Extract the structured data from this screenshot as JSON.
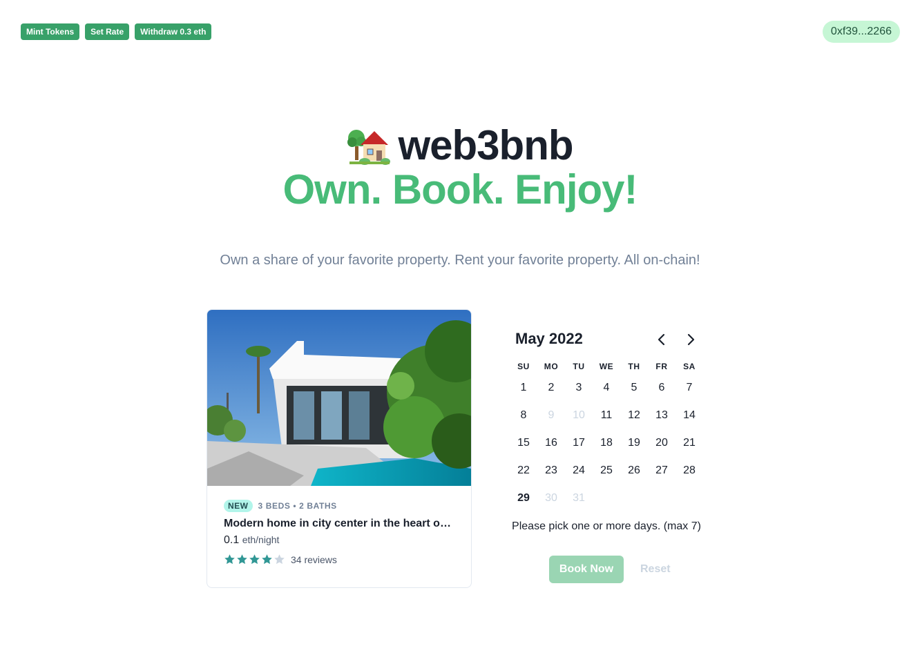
{
  "toolbar": {
    "mint_label": "Mint Tokens",
    "set_rate_label": "Set Rate",
    "withdraw_label": "Withdraw 0.3 eth"
  },
  "wallet": {
    "address": "0xf39...2266"
  },
  "hero": {
    "logo_icon": "house-with-garden-icon",
    "title": "web3bnb",
    "tagline": "Own. Book. Enjoy!",
    "subtitle": "Own a share of your favorite property. Rent your favorite property. All on-chain!"
  },
  "property": {
    "image": "modern-house-photo",
    "badge": "NEW",
    "beds_baths": "3 BEDS • 2 BATHS",
    "title": "Modern home in city center in the heart of historic Los Angeles",
    "price": "0.1",
    "price_unit": "eth/night",
    "rating": 4,
    "rating_max": 5,
    "reviews": "34 reviews"
  },
  "calendar": {
    "month": "May 2022",
    "weekdays": [
      "SU",
      "MO",
      "TU",
      "WE",
      "TH",
      "FR",
      "SA"
    ],
    "weeks": [
      [
        "1",
        "2",
        "3",
        "4",
        "5",
        "6",
        "7"
      ],
      [
        "8",
        "9",
        "10",
        "11",
        "12",
        "13",
        "14"
      ],
      [
        "15",
        "16",
        "17",
        "18",
        "19",
        "20",
        "21"
      ],
      [
        "22",
        "23",
        "24",
        "25",
        "26",
        "27",
        "28"
      ],
      [
        "29",
        "30",
        "31",
        "",
        "",
        "",
        ""
      ]
    ],
    "disabled_days": [
      "9",
      "10",
      "30",
      "31"
    ],
    "today": "29",
    "note": "Please pick one or more days. (max 7)",
    "book_label": "Book Now",
    "reset_label": "Reset"
  },
  "colors": {
    "brand_green": "#48bb78",
    "button_green": "#38a169",
    "wallet_bg": "#c6f6d5",
    "teal_star": "#319795"
  }
}
